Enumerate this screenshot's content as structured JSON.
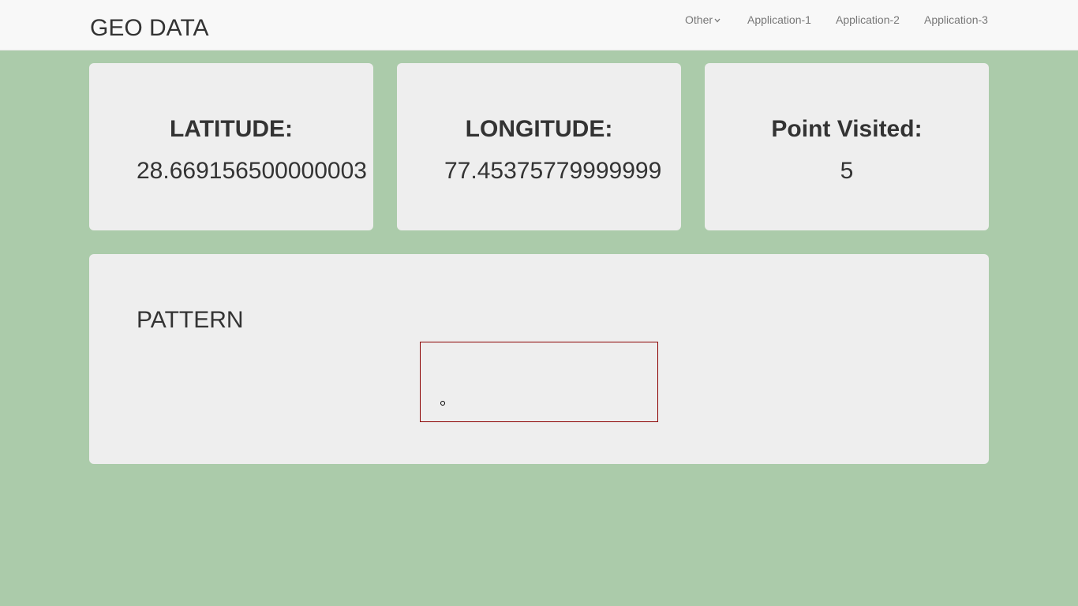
{
  "navbar": {
    "brand": "GEO DATA",
    "items": [
      {
        "label": "Other",
        "has_dropdown": true
      },
      {
        "label": "Application-1"
      },
      {
        "label": "Application-2"
      },
      {
        "label": "Application-3"
      }
    ]
  },
  "stats": {
    "latitude": {
      "label": "LATITUDE:",
      "value": "28.669156500000003"
    },
    "longitude": {
      "label": "LONGITUDE:",
      "value": "77.45375779999999"
    },
    "points": {
      "label": "Point Visited:",
      "value": "5"
    }
  },
  "pattern": {
    "title": "PATTERN",
    "canvas_border_color": "#8b0000"
  },
  "colors": {
    "page_background": "#abcbaa",
    "card_background": "#eeeeee",
    "navbar_background": "#f8f8f8",
    "text": "#333333",
    "nav_text": "#777777"
  }
}
